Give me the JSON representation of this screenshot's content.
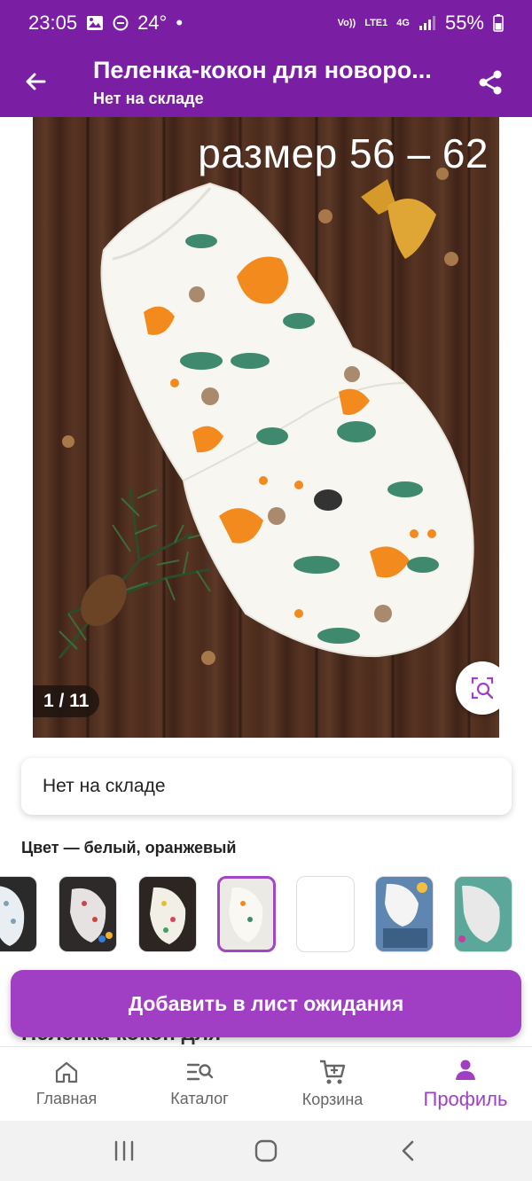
{
  "status_bar": {
    "time": "23:05",
    "temperature": "24°",
    "network_volte": "Vo))",
    "network_lte": "LTE1",
    "network_4g": "4G",
    "battery": "55%"
  },
  "app_bar": {
    "title": "Пеленка-кокон для новоро...",
    "subtitle": "Нет на складе"
  },
  "product_image": {
    "overlay_text": "размер 56 – 62",
    "counter": "1 / 11"
  },
  "stock": {
    "text": "Нет на складе"
  },
  "color_selector": {
    "label": "Цвет — белый, оранжевый",
    "selected_index": 3
  },
  "sheet": {
    "peek_text": "Пеленка-кокон для",
    "wait_button": "Добавить в лист ожидания"
  },
  "bottom_nav": {
    "items": [
      {
        "label": "Главная",
        "icon": "home-icon"
      },
      {
        "label": "Каталог",
        "icon": "catalog-search-icon"
      },
      {
        "label": "Корзина",
        "icon": "cart-icon"
      },
      {
        "label": "Профиль",
        "icon": "profile-icon",
        "active": true
      }
    ]
  },
  "colors": {
    "primary": "#7a1fa3",
    "accent": "#a13fc4"
  }
}
